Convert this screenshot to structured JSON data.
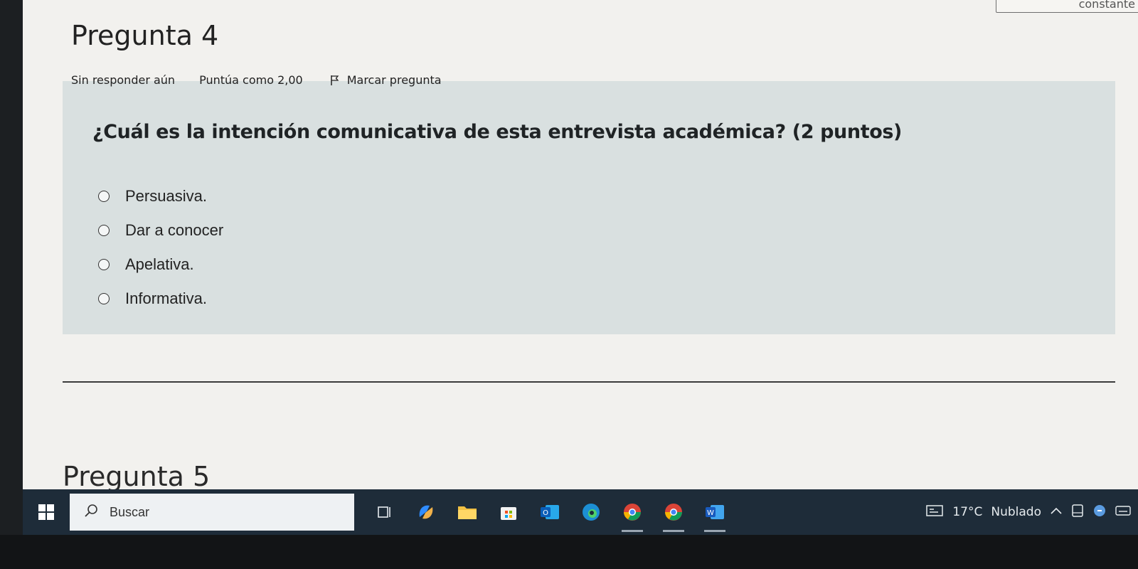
{
  "corner": {
    "text": "constante"
  },
  "question": {
    "title": "Pregunta 4",
    "status": "Sin responder aún",
    "grade": "Puntúa como 2,00",
    "flag_label": "Marcar pregunta",
    "text": "¿Cuál es la intención comunicativa de esta entrevista académica? (2 puntos)",
    "options": [
      {
        "label": "Persuasiva."
      },
      {
        "label": "Dar a conocer"
      },
      {
        "label": "Apelativa."
      },
      {
        "label": "Informativa."
      }
    ]
  },
  "next_question": {
    "title": "Pregunta 5"
  },
  "taskbar": {
    "search_placeholder": "Buscar",
    "weather_temp": "17°C",
    "weather_text": "Nublado",
    "icons": [
      "windows-start-icon",
      "task-view-icon",
      "copilot-icon",
      "file-explorer-icon",
      "microsoft-store-icon",
      "outlook-icon",
      "edge-icon",
      "chrome-icon",
      "chrome-profile-icon",
      "word-icon"
    ]
  }
}
